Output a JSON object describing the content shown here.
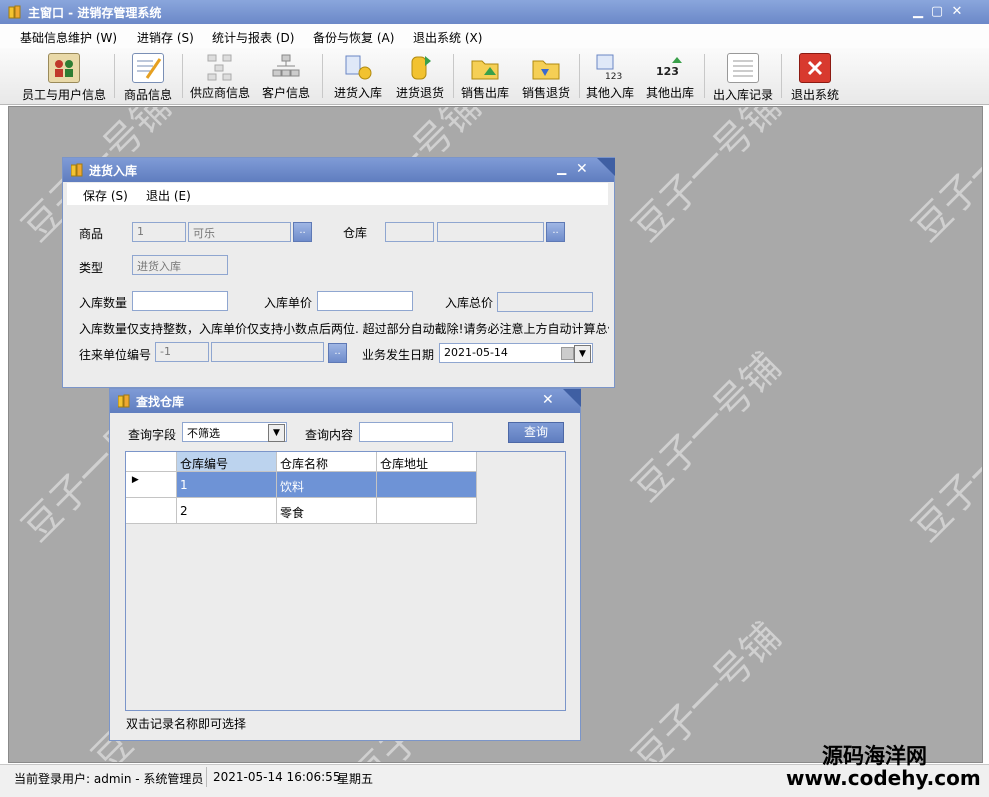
{
  "window": {
    "title": "主窗口 - 进销存管理系统",
    "minimize_icon": "minimize-icon",
    "maximize_icon": "maximize-icon",
    "close_icon": "close-icon"
  },
  "menu": [
    "基础信息维护 (W)",
    "进销存 (S)",
    "统计与报表 (D)",
    "备份与恢复 (A)",
    "退出系统 (X)"
  ],
  "toolbar": [
    {
      "label": "员工与用户信息",
      "icon": "users-icon"
    },
    {
      "label": "商品信息",
      "icon": "edit-form-icon"
    },
    {
      "label": "供应商信息",
      "icon": "org-chart-gray-icon"
    },
    {
      "label": "客户信息",
      "icon": "org-chart-icon"
    },
    {
      "label": "进货入库",
      "icon": "stock-in-icon"
    },
    {
      "label": "进货退货",
      "icon": "purchase-return-icon"
    },
    {
      "label": "销售出库",
      "icon": "sales-out-icon"
    },
    {
      "label": "销售退货",
      "icon": "sales-return-icon"
    },
    {
      "label": "其他入库",
      "icon": "other-in-icon"
    },
    {
      "label": "其他出库",
      "icon": "other-out-icon"
    },
    {
      "label": "出入库记录",
      "icon": "records-icon"
    },
    {
      "label": "退出系统",
      "icon": "exit-icon"
    }
  ],
  "watermark": "豆子一号铺",
  "stock_in": {
    "title": "进货入库",
    "menu": {
      "save": "保存 (S)",
      "exit": "退出 (E)"
    },
    "product_label": "商品",
    "product_id": "1",
    "product_name": "可乐",
    "warehouse_label": "仓库",
    "type_label": "类型",
    "type_value": "进货入库",
    "qty_label": "入库数量",
    "price_label": "入库单价",
    "total_label": "入库总价",
    "hint": "入库数量仅支持整数，入库单价仅支持小数点后两位. 超过部分自动截除!请务必注意上方自动计算总价",
    "partner_label": "往来单位编号",
    "partner_id": "-1",
    "date_label": "业务发生日期",
    "date_value": "2021-05-14"
  },
  "find_warehouse": {
    "title": "查找仓库",
    "field_label": "查询字段",
    "field_value": "不筛选",
    "content_label": "查询内容",
    "query_button": "查询",
    "columns": [
      "仓库编号",
      "仓库名称",
      "仓库地址"
    ],
    "rows": [
      [
        "1",
        "饮料",
        ""
      ],
      [
        "2",
        "零食",
        ""
      ]
    ],
    "hint": "双击记录名称即可选择"
  },
  "status": {
    "user": "当前登录用户: admin - 系统管理员",
    "datetime": "2021-05-14 16:06:55",
    "weekday": "星期五"
  },
  "corner_brand": {
    "name": "源码海洋网",
    "url": "www.codehy.com"
  }
}
